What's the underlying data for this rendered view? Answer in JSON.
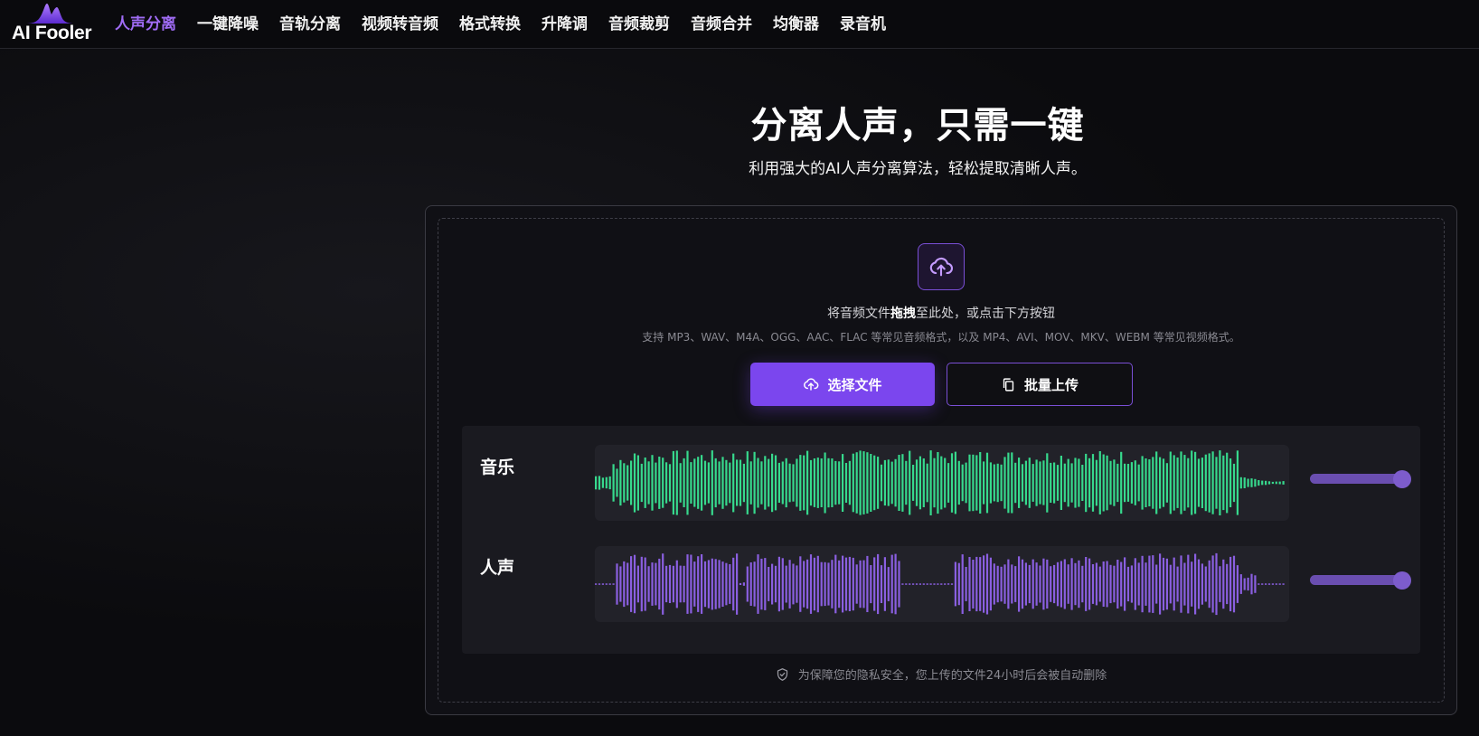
{
  "brand": {
    "name": "AI Fooler",
    "accent": "#a06cf5"
  },
  "nav": {
    "items": [
      {
        "label": "人声分离",
        "active": true
      },
      {
        "label": "一键降噪",
        "active": false
      },
      {
        "label": "音轨分离",
        "active": false
      },
      {
        "label": "视频转音频",
        "active": false
      },
      {
        "label": "格式转换",
        "active": false
      },
      {
        "label": "升降调",
        "active": false
      },
      {
        "label": "音频裁剪",
        "active": false
      },
      {
        "label": "音频合并",
        "active": false
      },
      {
        "label": "均衡器",
        "active": false
      },
      {
        "label": "录音机",
        "active": false
      }
    ]
  },
  "hero": {
    "title": "分离人声，只需一键",
    "subtitle": "利用强大的AI人声分离算法，轻松提取清晰人声。"
  },
  "upload": {
    "icon": "cloud-upload-icon",
    "hint_prefix": "将音频文件",
    "hint_bold": "拖拽",
    "hint_suffix": "至此处，或点击下方按钮",
    "formats": "支持 MP3、WAV、M4A、OGG、AAC、FLAC 等常见音频格式，以及 MP4、AVI、MOV、MKV、WEBM 等常见视频格式。",
    "select_label": "选择文件",
    "batch_label": "批量上传",
    "primary_color": "#7b46ee"
  },
  "tracks": [
    {
      "label": "音乐",
      "color": "#37d98d",
      "volume": 1.0
    },
    {
      "label": "人声",
      "color": "#8a5fe0",
      "volume": 1.0
    }
  ],
  "privacy": {
    "icon": "shield-check-icon",
    "text": "为保障您的隐私安全，您上传的文件24小时后会被自动删除"
  }
}
